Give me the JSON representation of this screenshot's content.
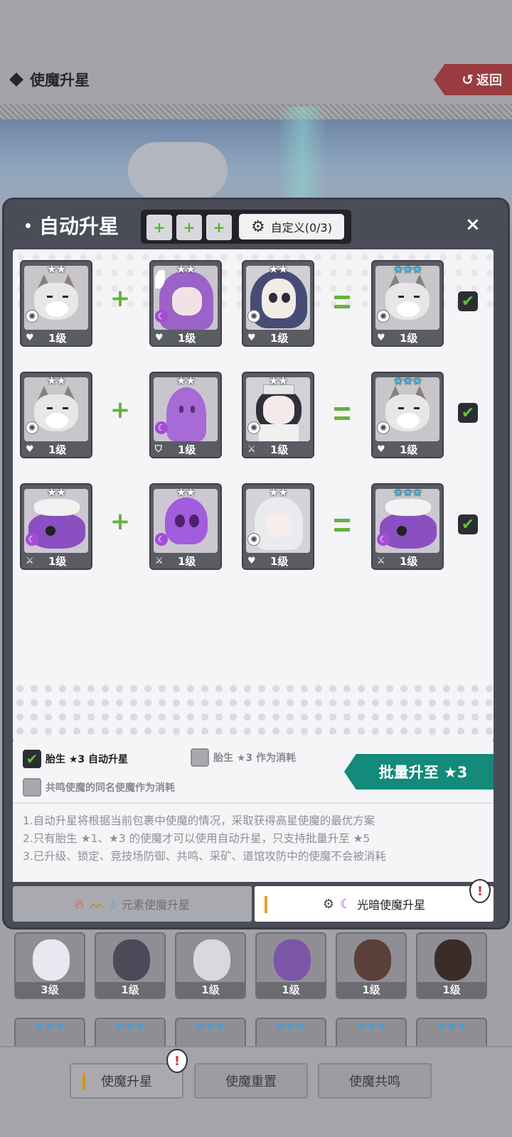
{
  "header": {
    "title": "使魔升星",
    "back_label": "返回"
  },
  "dialog": {
    "title": "自动升星",
    "slots": [
      "+",
      "+",
      "+"
    ],
    "custom_label": "自定义(0/3)",
    "close": "×",
    "rows": [
      {
        "cards": [
          {
            "art": "wolf",
            "stars": "★★",
            "element": "light",
            "role": "♥",
            "level": "1级"
          },
          {
            "art": "violet",
            "stars": "★★",
            "element": "dark",
            "role": "♥",
            "level": "1级"
          },
          {
            "art": "skull",
            "stars": "★★",
            "element": "light",
            "role": "♥",
            "level": "1级"
          }
        ],
        "result": {
          "art": "wolf",
          "stars": "★★★",
          "element": "light",
          "role": "♥",
          "level": "1级"
        },
        "checked": true
      },
      {
        "cards": [
          {
            "art": "wolf",
            "stars": "★★",
            "element": "light",
            "role": "♥",
            "level": "1级"
          },
          {
            "art": "purple",
            "stars": "★★",
            "element": "dark",
            "role": "⛉",
            "level": "1级"
          },
          {
            "art": "priest",
            "stars": "★★",
            "element": "light",
            "role": "⚔",
            "level": "1级"
          }
        ],
        "result": {
          "art": "wolf",
          "stars": "★★★",
          "element": "light",
          "role": "♥",
          "level": "1级"
        },
        "checked": true
      },
      {
        "cards": [
          {
            "art": "octo",
            "stars": "★★",
            "element": "dark",
            "role": "⚔",
            "level": "1级"
          },
          {
            "art": "ghost",
            "stars": "★★",
            "element": "dark",
            "role": "⚔",
            "level": "1级"
          },
          {
            "art": "nun",
            "stars": "★★",
            "element": "light",
            "role": "♥",
            "level": "1级"
          }
        ],
        "result": {
          "art": "octo",
          "stars": "★★★",
          "element": "dark",
          "role": "⚔",
          "level": "1级"
        },
        "checked": true
      }
    ],
    "options": {
      "auto_label": "胎生 ★3 自动升星",
      "consume_label": "胎生 ★3 作为消耗",
      "resonance_label": "共鸣使魔的同名使魔作为消耗"
    },
    "batch_button": "批量升至 ★3",
    "notes": [
      "1.自动升星将根据当前包裹中使魔的情况，采取获得高星使魔的最优方案",
      "2.只有胎生 ★1、★3 的使魔才可以使用自动升星，只支持批量升至 ★5",
      "3.已升级、锁定、竞技场防御、共鸣、采矿、道馆攻防中的使魔不会被消耗"
    ],
    "tabs": {
      "elemental": "元素使魔升星",
      "light_dark": "光暗使魔升星"
    }
  },
  "background_cards": [
    {
      "level": "3级",
      "color": "#e9e7ef"
    },
    {
      "level": "1级",
      "color": "#4b4a58"
    },
    {
      "level": "1级",
      "color": "#d9d8dc"
    },
    {
      "level": "1级",
      "color": "#7a55a8"
    },
    {
      "level": "1级",
      "color": "#5a4038"
    },
    {
      "level": "1级",
      "color": "#3b2c2a"
    }
  ],
  "bottom_tabs": [
    "使魔升星",
    "使魔重置",
    "使魔共鸣"
  ],
  "colors": {
    "accent_green": "#62b43f",
    "batch_teal": "#138a7a",
    "back_red": "#9a3b3f",
    "alert_red": "#c83a3a"
  }
}
